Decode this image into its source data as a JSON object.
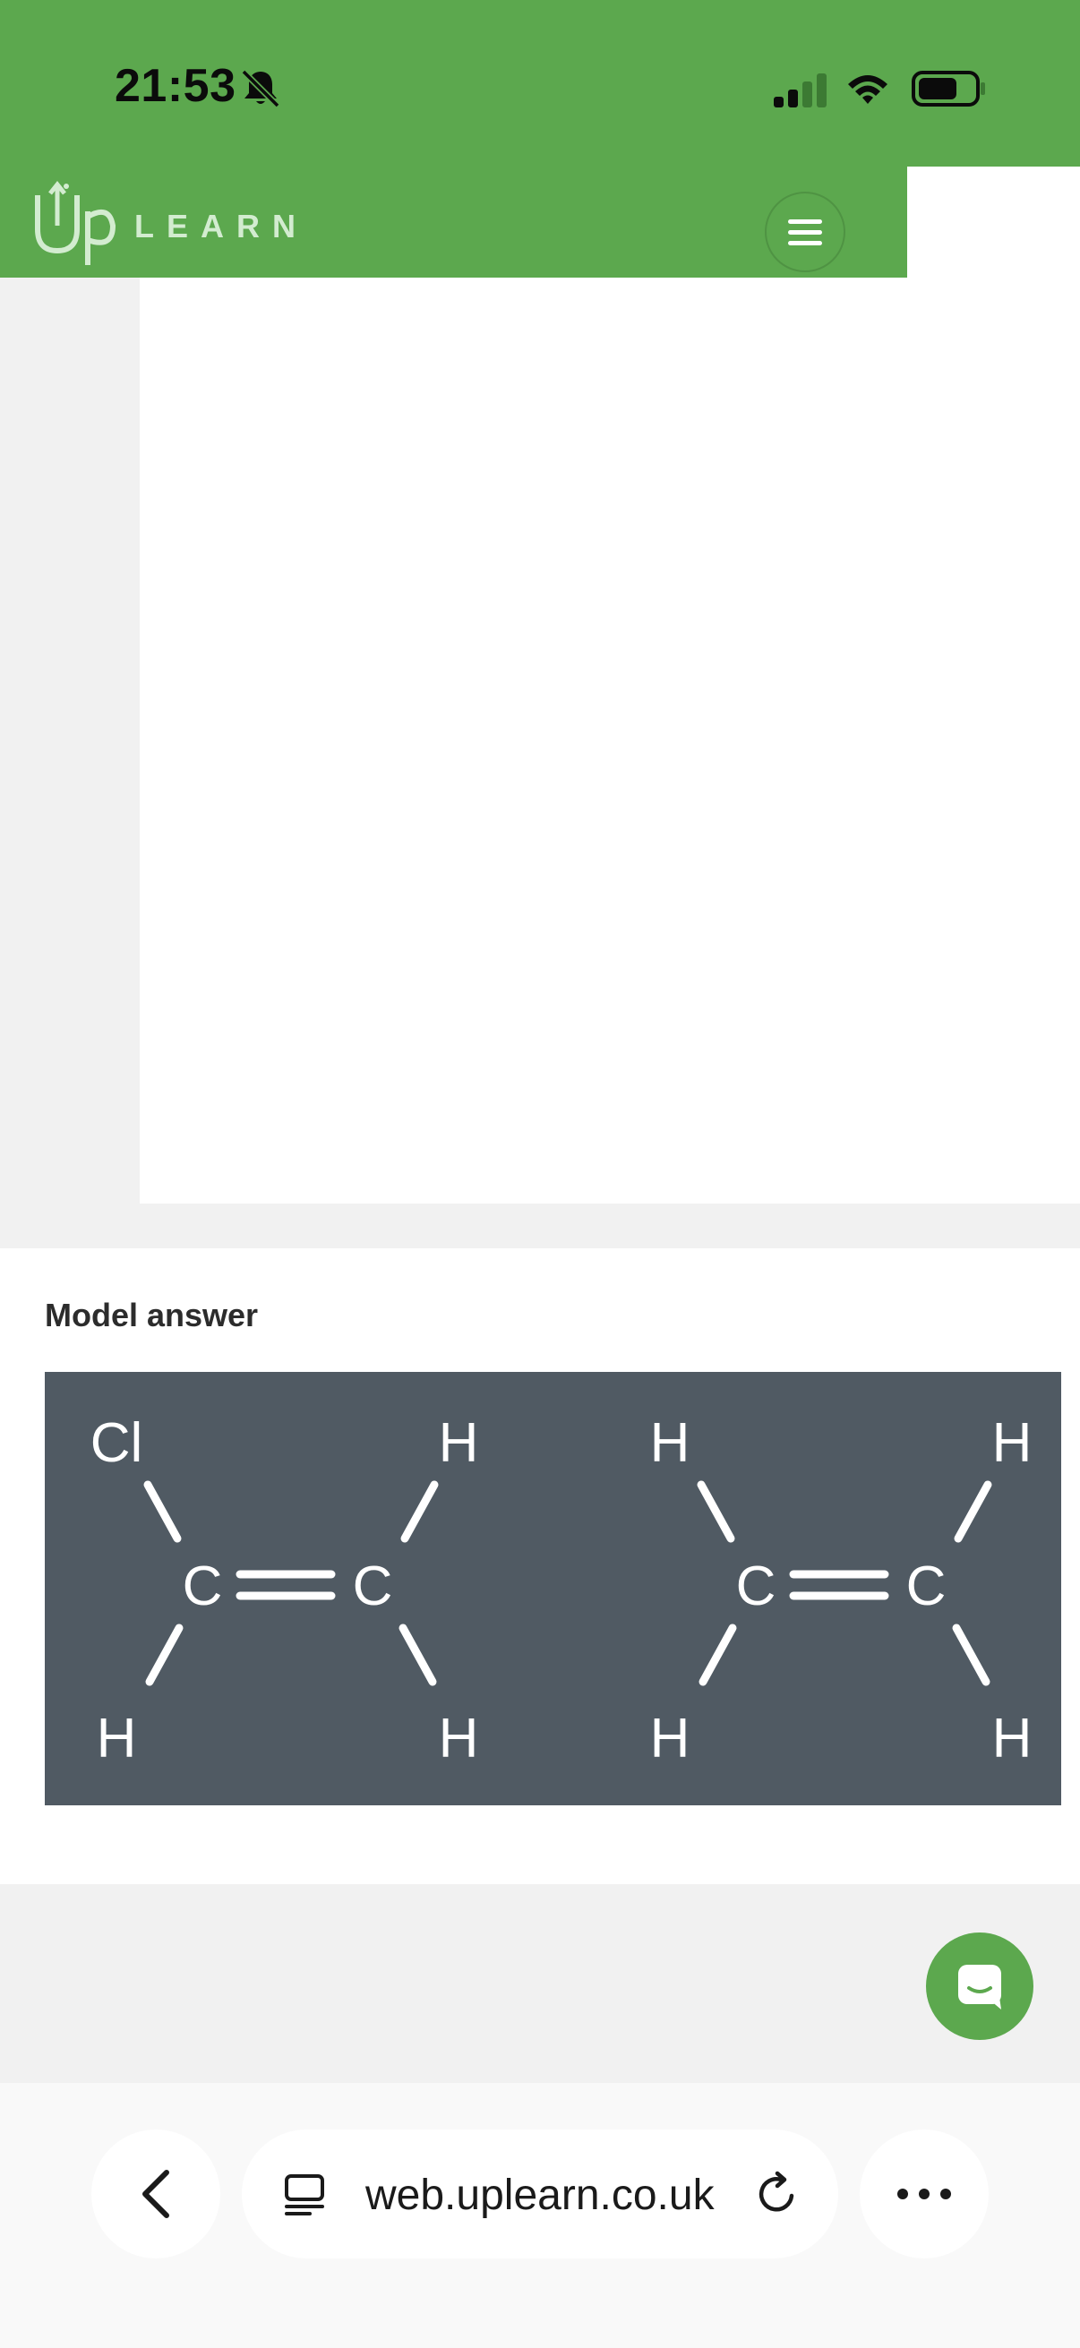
{
  "status_bar": {
    "time": "21:53",
    "silent_icon": "bell-slash-icon",
    "signal_icon": "cellular-signal-icon",
    "wifi_icon": "wifi-icon",
    "battery_icon": "battery-icon"
  },
  "header": {
    "logo_mark": "Up",
    "logo_word": "LEARN",
    "menu_icon": "hamburger-menu-icon",
    "brand_color": "#5ca84e"
  },
  "answer": {
    "title": "Model answer",
    "molecule_1": {
      "atom_top_left": "Cl",
      "atom_top_right": "H",
      "atom_bottom_left": "H",
      "atom_bottom_right": "H",
      "carbon_left": "C",
      "carbon_right": "C"
    },
    "molecule_2": {
      "atom_top_left": "H",
      "atom_top_right": "H",
      "atom_bottom_left": "H",
      "atom_bottom_right": "H",
      "carbon_left": "C",
      "carbon_right": "C"
    },
    "image_background": "#505a63"
  },
  "chat": {
    "icon": "chat-bubble-icon"
  },
  "browser": {
    "url": "web.uplearn.co.uk",
    "back_icon": "chevron-left-icon",
    "tabs_icon": "tabs-icon",
    "reload_icon": "reload-icon",
    "more_icon": "ellipsis-icon"
  }
}
